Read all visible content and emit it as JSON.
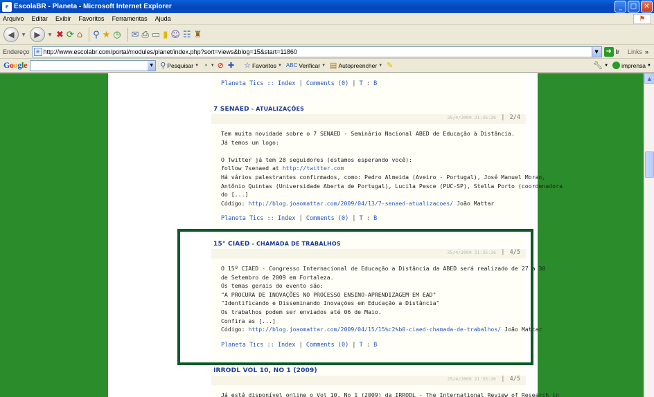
{
  "window": {
    "title": "EscolaBR - Planeta - Microsoft Internet Explorer",
    "buttons": [
      "_",
      "□",
      "✕"
    ]
  },
  "menu": [
    "Arquivo",
    "Editar",
    "Exibir",
    "Favoritos",
    "Ferramentas",
    "Ajuda"
  ],
  "address": {
    "label": "Endereço",
    "url": "http://www.escolabr.com/portal/modules/planet/index.php?sort=views&blog=15&start=11860",
    "go_label": "Ir",
    "links_label": "Links"
  },
  "google": {
    "search_placeholder": "",
    "items": [
      "Pesquisar",
      "Favoritos",
      "Verificar",
      "Autopreencher"
    ],
    "right_label": "imprensa"
  },
  "posts": [
    {
      "footer": {
        "blog": "Planeta Tics :: Index",
        "comments": "Comments (0)",
        "t": "T",
        "b": "B"
      }
    },
    {
      "title_big": "7 SENAED",
      "title_rest": " - ATUALIZAÇÕES",
      "timestamp": "25/4/2009 21:35:26",
      "page": "2/4",
      "lines": [
        "Tem muita novidade sobre o 7 SENAED - Seminário Nacional ABED de Educação à Distância.",
        "Já temos um logo:",
        "",
        "O Twitter já tem 28 seguidores (estamos esperando você):",
        "follow 7senaed at ",
        "Há vários palestrantes confirmados, como: Pedro Almeida (Aveiro - Portugal), José Manuel Moran,",
        "Antônio Quintas (Universidade Aberta de Portugal), Lucila Pesce (PUC-SP), Stella Porto (coordenadora",
        "do [...]"
      ],
      "follow_link": "http://twitter.com",
      "source_label": "Código: ",
      "source_url": "http://blog.joaomattar.com/2009/04/13/7-senaed-atualizacoes/",
      "source_author": " João Mattar",
      "footer": {
        "blog": "Planeta Tics :: Index",
        "comments": "Comments (0)",
        "t": "T",
        "b": "B"
      }
    },
    {
      "title_big": "15° CIAED",
      "title_rest": " - CHAMADA DE TRABALHOS",
      "timestamp": "25/4/2009 21:35:26",
      "page": "4/5",
      "lines": [
        "O 15º CIAED - Congresso Internacional de Educação a Distância da ABED será realizado de 27 a 30",
        "de Setembro de 2009 em Fortaleza.",
        "Os temas gerais do evento são:",
        "\"A PROCURA DE INOVAÇÕES NO PROCESSO ENSINO-APRENDIZAGEM EM EAD\"",
        "\"Identificando e Disseminando Inovações em Educação a Distância\"",
        "Os trabalhos podem ser enviados até 06 de Maio.",
        "Confira as [...]"
      ],
      "source_label": "Código: ",
      "source_url": "http://blog.joaomattar.com/2009/04/15/15%c2%b0-ciaed-chamada-de-trabalhos/",
      "source_author": " João Mattar",
      "footer": {
        "blog": "Planeta Tics :: Index",
        "comments": "Comments (0)",
        "t": "T",
        "b": "B"
      }
    },
    {
      "title_big": "IRRODL VOL 10, NO 1 (2009)",
      "timestamp": "25/4/2009 21:35:26",
      "page": "4/5",
      "lines": [
        "Já está disponível online o Vol 10, No 1 (2009) da IRRODL - The International Review of Research in"
      ]
    }
  ],
  "colors": {
    "page_bg": "#2b8c2b",
    "highlight": "#0c5a28",
    "link": "#2255bb"
  }
}
